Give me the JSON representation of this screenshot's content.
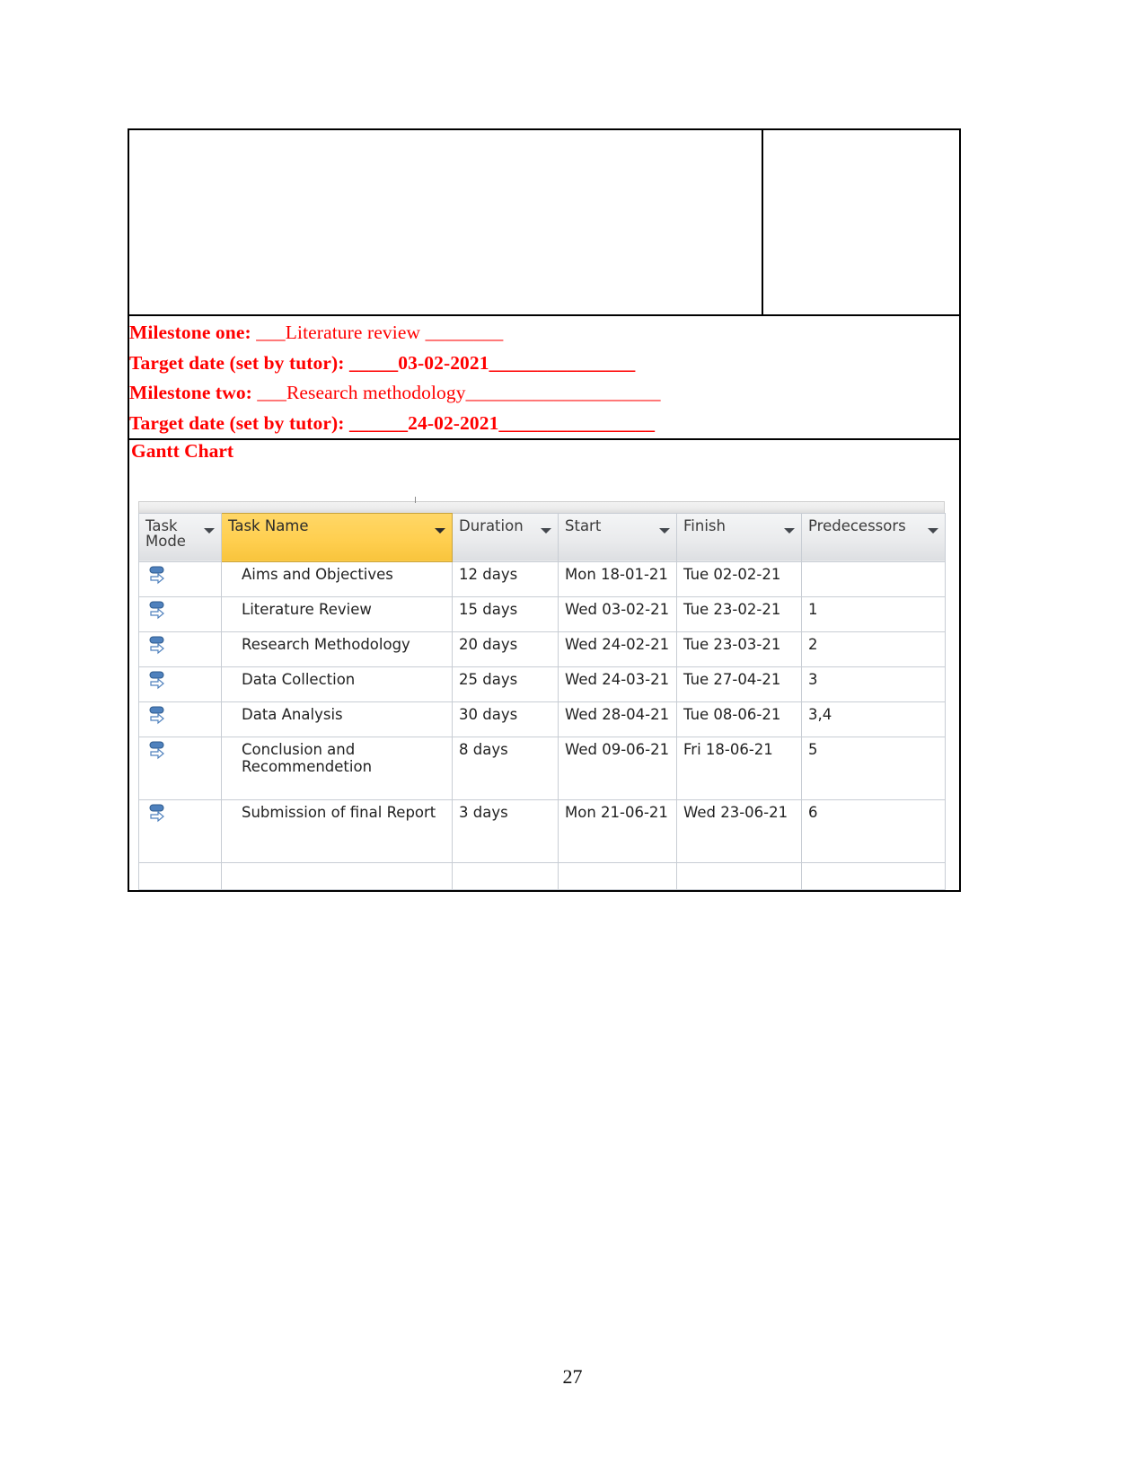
{
  "document": {
    "page_number": "27"
  },
  "milestones": {
    "one_label": "Milestone one:",
    "one_value": "___Literature review ________",
    "one_target_label": "Target date (set by tutor):",
    "one_target_value": "_____03-02-2021_______________",
    "two_label": "Milestone two:",
    "two_value": "___Research methodology____________________",
    "two_target_label": "Target date (set by tutor):",
    "two_target_value": "______24-02-2021________________"
  },
  "gantt": {
    "title": "Gantt Chart",
    "columns": [
      {
        "key": "mode",
        "label": "Task\nMode",
        "highlighted": false
      },
      {
        "key": "name",
        "label": "Task Name",
        "highlighted": true
      },
      {
        "key": "dur",
        "label": "Duration",
        "highlighted": false
      },
      {
        "key": "start",
        "label": "Start",
        "highlighted": false
      },
      {
        "key": "fin",
        "label": "Finish",
        "highlighted": false
      },
      {
        "key": "pred",
        "label": "Predecessors",
        "highlighted": false
      }
    ],
    "column_labels": {
      "mode": "Task Mode",
      "mode_line1": "Task",
      "mode_line2": "Mode",
      "name": "Task Name",
      "dur": "Duration",
      "start": "Start",
      "fin": "Finish",
      "pred": "Predecessors"
    },
    "highlight_color": "#ffcf50",
    "header_color": "#e9eaec",
    "icon": "auto-scheduled-task-icon",
    "rows": [
      {
        "mode": "auto-scheduled-task-icon",
        "name": "Aims and Objectives",
        "dur": "12 days",
        "start": "Mon 18-01-21",
        "fin": "Tue 02-02-21",
        "pred": ""
      },
      {
        "mode": "auto-scheduled-task-icon",
        "name": "Literature Review",
        "dur": "15 days",
        "start": "Wed 03-02-21",
        "fin": "Tue 23-02-21",
        "pred": "1"
      },
      {
        "mode": "auto-scheduled-task-icon",
        "name": "Research Methodology",
        "dur": "20 days",
        "start": "Wed 24-02-21",
        "fin": "Tue 23-03-21",
        "pred": "2"
      },
      {
        "mode": "auto-scheduled-task-icon",
        "name": "Data Collection",
        "dur": "25 days",
        "start": "Wed 24-03-21",
        "fin": "Tue 27-04-21",
        "pred": "3"
      },
      {
        "mode": "auto-scheduled-task-icon",
        "name": "Data Analysis",
        "dur": "30 days",
        "start": "Wed 28-04-21",
        "fin": "Tue 08-06-21",
        "pred": "3,4"
      },
      {
        "mode": "auto-scheduled-task-icon",
        "name": "Conclusion and Recommendetion",
        "dur": "8 days",
        "start": "Wed 09-06-21",
        "fin": "Fri 18-06-21",
        "pred": "5"
      },
      {
        "mode": "auto-scheduled-task-icon",
        "name": "Submission of final Report",
        "dur": "3 days",
        "start": "Mon 21-06-21",
        "fin": "Wed 23-06-21",
        "pred": "6"
      }
    ]
  }
}
